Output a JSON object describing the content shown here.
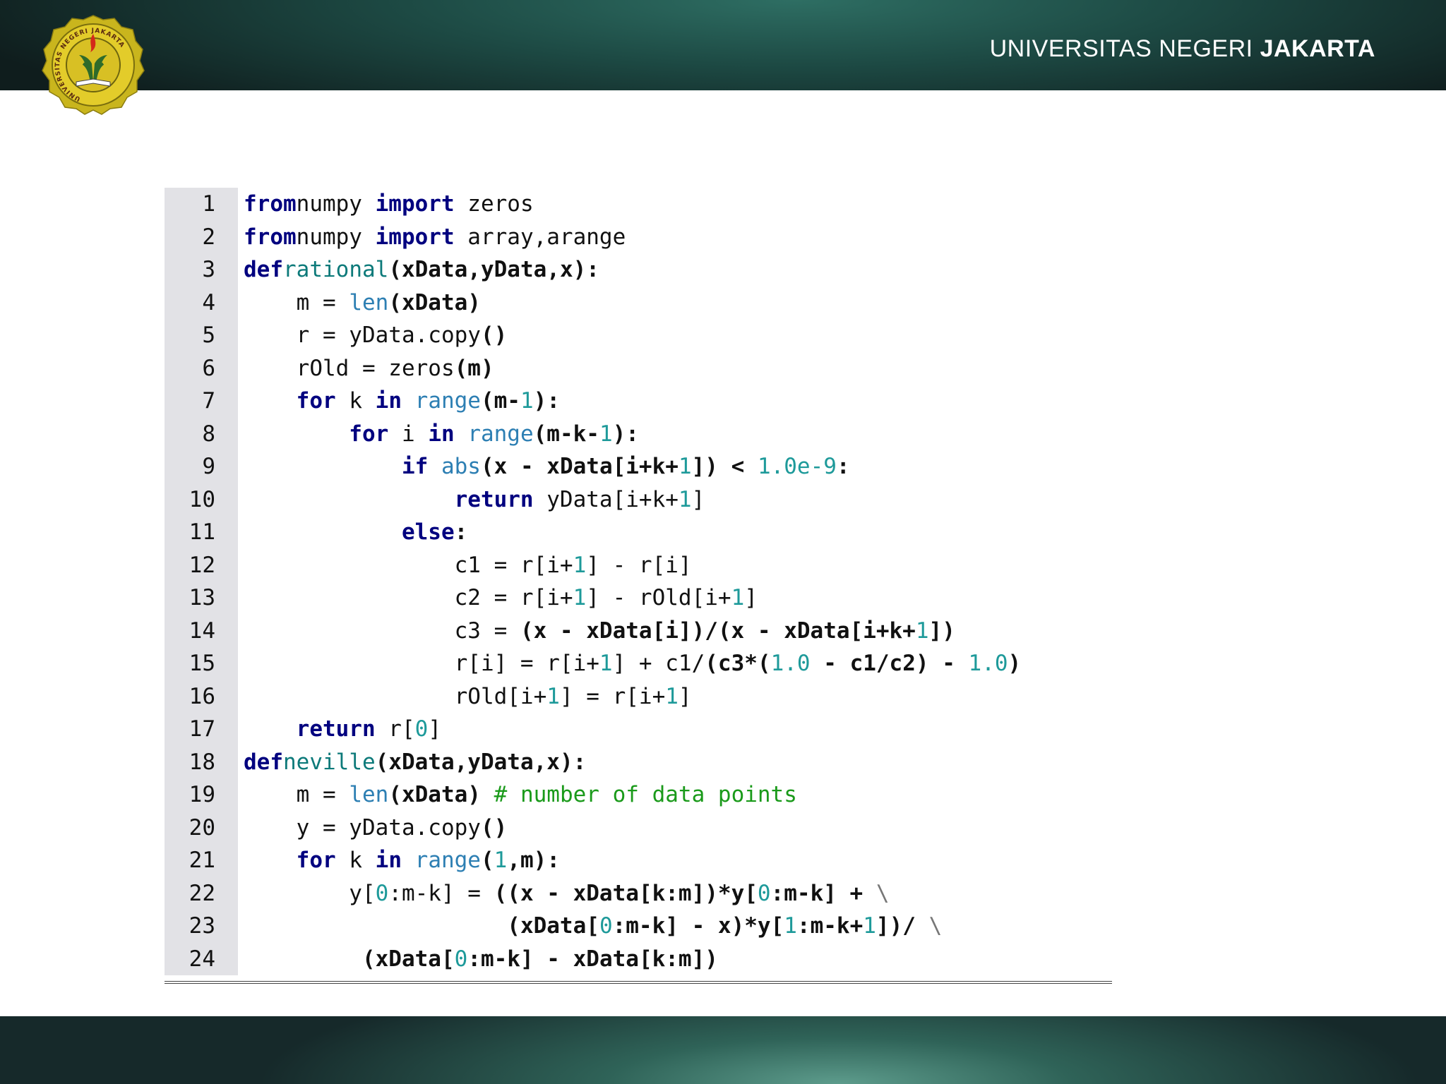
{
  "header": {
    "title_regular": "UNIVERSITAS NEGERI",
    "title_bold": "JAKARTA",
    "logo_text": "UNIVERSITAS NEGERI JAKARTA"
  },
  "code": {
    "lines": [
      {
        "num": "1"
      },
      {
        "num": "2"
      },
      {
        "num": "3"
      },
      {
        "num": "4"
      },
      {
        "num": "5"
      },
      {
        "num": "6"
      },
      {
        "num": "7"
      },
      {
        "num": "8"
      },
      {
        "num": "9"
      },
      {
        "num": "10"
      },
      {
        "num": "11"
      },
      {
        "num": "12"
      },
      {
        "num": "13"
      },
      {
        "num": "14"
      },
      {
        "num": "15"
      },
      {
        "num": "16"
      },
      {
        "num": "17"
      },
      {
        "num": "18"
      },
      {
        "num": "19"
      },
      {
        "num": "20"
      },
      {
        "num": "21"
      },
      {
        "num": "22"
      },
      {
        "num": "23"
      },
      {
        "num": "24"
      }
    ],
    "tokens": [
      [
        [
          "kw",
          "from"
        ],
        [
          "",
          "numpy "
        ],
        [
          "kw",
          "import"
        ],
        [
          "",
          " zeros"
        ]
      ],
      [
        [
          "kw",
          "from"
        ],
        [
          "",
          "numpy "
        ],
        [
          "kw",
          "import"
        ],
        [
          "",
          " array,arange"
        ]
      ],
      [
        [
          "kw",
          "def"
        ],
        [
          "",
          ""
        ],
        [
          "fn",
          "rational"
        ],
        [
          "op",
          "(xData,yData,x):"
        ]
      ],
      [
        [
          "",
          "    m = "
        ],
        [
          "bi",
          "len"
        ],
        [
          "op",
          "(xData)"
        ]
      ],
      [
        [
          "",
          "    r = yData.copy"
        ],
        [
          "op",
          "()"
        ]
      ],
      [
        [
          "",
          "    rOld = zeros"
        ],
        [
          "op",
          "(m)"
        ]
      ],
      [
        [
          "kw",
          "    for"
        ],
        [
          "",
          " k "
        ],
        [
          "kw",
          "in"
        ],
        [
          "",
          " "
        ],
        [
          "bi",
          "range"
        ],
        [
          "op",
          "(m-"
        ],
        [
          "num",
          "1"
        ],
        [
          "op",
          "):"
        ]
      ],
      [
        [
          "kw",
          "        for"
        ],
        [
          "",
          " i "
        ],
        [
          "kw",
          "in"
        ],
        [
          "",
          " "
        ],
        [
          "bi",
          "range"
        ],
        [
          "op",
          "(m-k-"
        ],
        [
          "num",
          "1"
        ],
        [
          "op",
          "):"
        ]
      ],
      [
        [
          "kw",
          "            if"
        ],
        [
          "",
          " "
        ],
        [
          "bi",
          "abs"
        ],
        [
          "op",
          "(x - xData[i+k+"
        ],
        [
          "num",
          "1"
        ],
        [
          "op",
          "]) < "
        ],
        [
          "num",
          "1.0e-9"
        ],
        [
          "op",
          ":"
        ]
      ],
      [
        [
          "kw",
          "                return"
        ],
        [
          "",
          " yData[i+k+"
        ],
        [
          "num",
          "1"
        ],
        [
          "",
          "]"
        ]
      ],
      [
        [
          "kw",
          "            else"
        ],
        [
          "op",
          ":"
        ]
      ],
      [
        [
          "",
          "                c1 = r[i+"
        ],
        [
          "num",
          "1"
        ],
        [
          "",
          "] - r[i]"
        ]
      ],
      [
        [
          "",
          "                c2 = r[i+"
        ],
        [
          "num",
          "1"
        ],
        [
          "",
          "] - rOld[i+"
        ],
        [
          "num",
          "1"
        ],
        [
          "",
          "]"
        ]
      ],
      [
        [
          "",
          "                c3 = "
        ],
        [
          "op",
          "(x - xData[i])/(x - xData[i+k+"
        ],
        [
          "num",
          "1"
        ],
        [
          "op",
          "])"
        ]
      ],
      [
        [
          "",
          "                r[i] = r[i+"
        ],
        [
          "num",
          "1"
        ],
        [
          "",
          "] + c1/"
        ],
        [
          "op",
          "(c3*("
        ],
        [
          "num",
          "1.0"
        ],
        [
          "op",
          " - c1/c2) - "
        ],
        [
          "num",
          "1.0"
        ],
        [
          "op",
          ")"
        ]
      ],
      [
        [
          "",
          "                rOld[i+"
        ],
        [
          "num",
          "1"
        ],
        [
          "",
          "] = r[i+"
        ],
        [
          "num",
          "1"
        ],
        [
          "",
          "]"
        ]
      ],
      [
        [
          "kw",
          "    return"
        ],
        [
          "",
          " r["
        ],
        [
          "num",
          "0"
        ],
        [
          "",
          "]"
        ]
      ],
      [
        [
          "kw",
          "def"
        ],
        [
          "",
          ""
        ],
        [
          "fn",
          "neville"
        ],
        [
          "op",
          "(xData,yData,x):"
        ]
      ],
      [
        [
          "",
          "    m = "
        ],
        [
          "bi",
          "len"
        ],
        [
          "op",
          "(xData) "
        ],
        [
          "cm",
          "# number of data points"
        ]
      ],
      [
        [
          "",
          "    y = yData.copy"
        ],
        [
          "op",
          "()"
        ]
      ],
      [
        [
          "kw",
          "    for"
        ],
        [
          "",
          " k "
        ],
        [
          "kw",
          "in"
        ],
        [
          "",
          " "
        ],
        [
          "bi",
          "range"
        ],
        [
          "op",
          "("
        ],
        [
          "num",
          "1"
        ],
        [
          "op",
          ",m):"
        ]
      ],
      [
        [
          "",
          "        y["
        ],
        [
          "num",
          "0"
        ],
        [
          "",
          ":m-k] = "
        ],
        [
          "op",
          "((x - xData[k:m])*y["
        ],
        [
          "num",
          "0"
        ],
        [
          "op",
          ":m-k] + "
        ],
        [
          "bs",
          "\\"
        ]
      ],
      [
        [
          "",
          "                    "
        ],
        [
          "op",
          "(xData["
        ],
        [
          "num",
          "0"
        ],
        [
          "op",
          ":m-k] - x)*y["
        ],
        [
          "num",
          "1"
        ],
        [
          "op",
          ":m-k+"
        ],
        [
          "num",
          "1"
        ],
        [
          "op",
          "])/ "
        ],
        [
          "bs",
          "\\"
        ]
      ],
      [
        [
          "",
          "         "
        ],
        [
          "op",
          "(xData["
        ],
        [
          "num",
          "0"
        ],
        [
          "op",
          ":m-k] - xData[k:m])"
        ]
      ]
    ]
  }
}
